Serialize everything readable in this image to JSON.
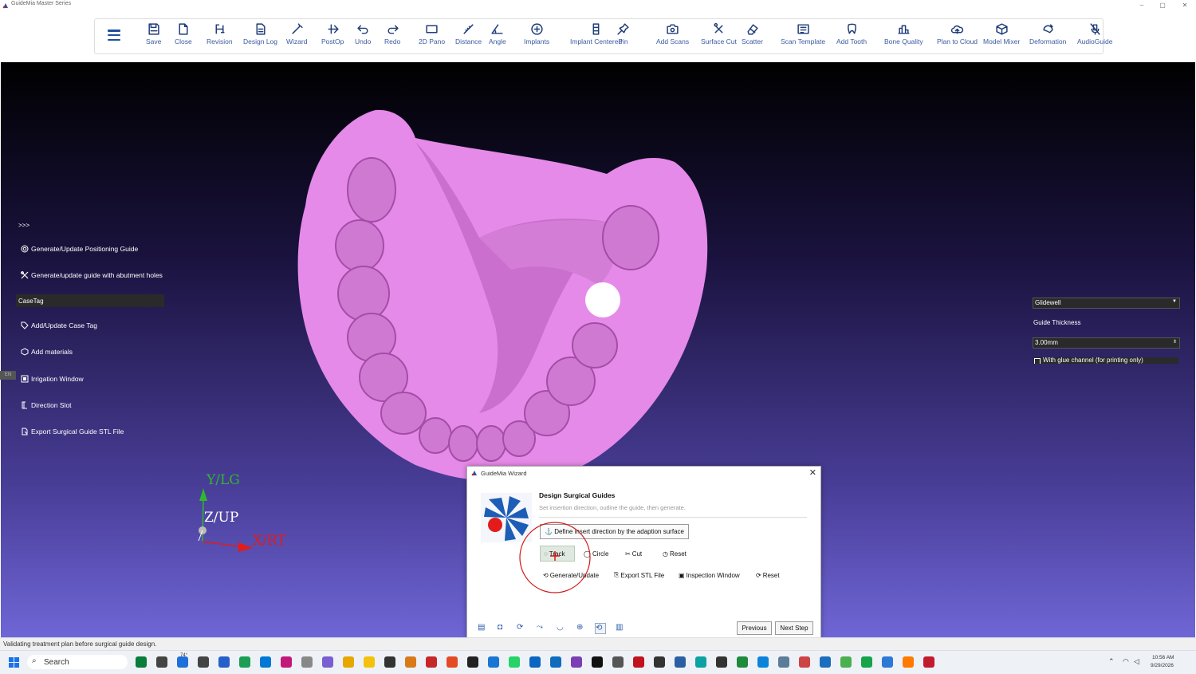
{
  "window": {
    "title": "GuideMia Master Series",
    "controls": [
      "–",
      "▢",
      "✕"
    ]
  },
  "toolbar": {
    "items": [
      {
        "label": "Save",
        "icon": "save-icon"
      },
      {
        "label": "Close",
        "icon": "close-file-icon"
      },
      {
        "label": "Revision",
        "icon": "revision-icon"
      },
      {
        "label": "Design Log",
        "icon": "design-log-icon"
      },
      {
        "label": "Wizard",
        "icon": "wizard-wand-icon"
      },
      {
        "label": "PostOp",
        "icon": "postop-icon"
      },
      {
        "label": "Undo",
        "icon": "undo-icon"
      },
      {
        "label": "Redo",
        "icon": "redo-icon"
      },
      {
        "label": "2D Pano",
        "icon": "pano-icon"
      },
      {
        "label": "Distance",
        "icon": "ruler-icon"
      },
      {
        "label": "Angle",
        "icon": "angle-icon"
      },
      {
        "label": "Implants",
        "icon": "implants-icon"
      },
      {
        "label": "Implant Centered",
        "icon": "implant-centered-icon"
      },
      {
        "label": "Pin",
        "icon": "pin-icon"
      },
      {
        "label": "Add Scans",
        "icon": "camera-icon"
      },
      {
        "label": "Surface Cut",
        "icon": "scissors-icon"
      },
      {
        "label": "Scatter",
        "icon": "eraser-icon"
      },
      {
        "label": "Scan Template",
        "icon": "scan-template-icon"
      },
      {
        "label": "Add Tooth",
        "icon": "tooth-icon"
      },
      {
        "label": "Bone Quality",
        "icon": "bar-chart-icon"
      },
      {
        "label": "Plan to Cloud",
        "icon": "cloud-upload-icon"
      },
      {
        "label": "Model Mixer",
        "icon": "cube-icon"
      },
      {
        "label": "Deformation",
        "icon": "deformation-icon"
      },
      {
        "label": "AudioGuide",
        "icon": "mic-off-icon"
      }
    ]
  },
  "left_panel": {
    "expand": ">>>",
    "items": [
      {
        "label": "Generate/Update Positioning Guide"
      },
      {
        "label": "Generate/update guide with abutment holes"
      }
    ],
    "case_tag_header": "CaseTag",
    "items2": [
      {
        "label": "Add/Update Case Tag"
      },
      {
        "label": "Add materials"
      },
      {
        "label": "Irrigation Window"
      },
      {
        "label": "Direction Slot"
      },
      {
        "label": "Export Surgical Guide STL File"
      }
    ],
    "side_tab": "EN"
  },
  "right_panel": {
    "lab": "Glidewell",
    "guide_thickness_label": "Guide Thickness",
    "guide_thickness_value": "3.00mm",
    "glue_channel_label": "With glue channel (for printing only)"
  },
  "axes": {
    "y": "Y/LG",
    "z": "Z/UP",
    "x": "X/RT",
    "colors": {
      "y": "#2fb82f",
      "z": "#ffffff",
      "x": "#e21b1b"
    }
  },
  "wizard": {
    "title": "GuideMia Wizard",
    "heading": "Design Surgical Guides",
    "subheading": "Set insertion direction, outline the guide, then generate.",
    "define_button": "Define insert direction by the adaption surface",
    "row1": [
      "Track",
      "Circle",
      "Cut",
      "Reset"
    ],
    "row2": [
      "Generate/Update",
      "Export STL File",
      "Inspection Window",
      "Reset"
    ],
    "previous": "Previous",
    "next": "Next Step"
  },
  "status": {
    "text": "Validating treatment plan before surgical guide design."
  },
  "taskbar": {
    "search": "Search",
    "weather": "74°",
    "time": "10:56 AM",
    "date": "9/29/2026"
  },
  "colors": {
    "model": "#e58ae8",
    "toolbar_icon": "#1f3d7a",
    "toolbar_text": "#3a5aa0"
  }
}
